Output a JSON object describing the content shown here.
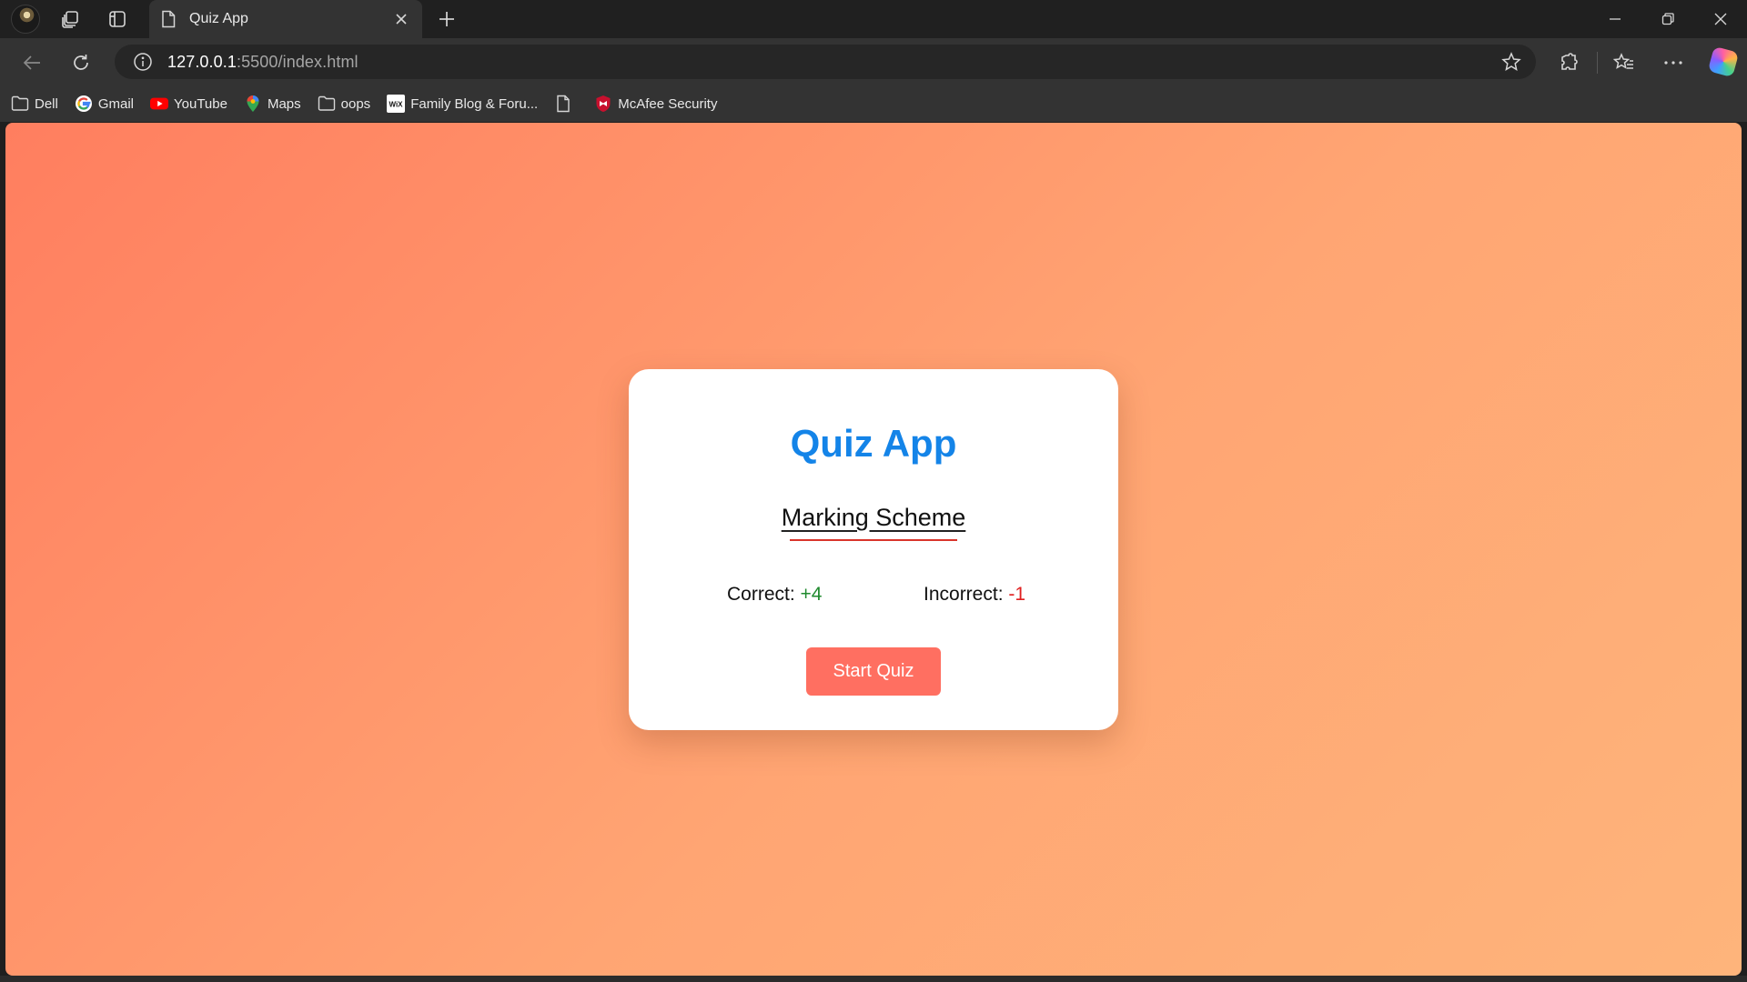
{
  "browser": {
    "tab": {
      "title": "Quiz App"
    },
    "address": {
      "host": "127.0.0.1",
      "rest": ":5500/index.html"
    },
    "bookmarks": [
      {
        "label": "Dell",
        "icon": "folder-icon"
      },
      {
        "label": "Gmail",
        "icon": "google-icon"
      },
      {
        "label": "YouTube",
        "icon": "youtube-icon"
      },
      {
        "label": "Maps",
        "icon": "maps-pin-icon"
      },
      {
        "label": "oops",
        "icon": "folder-icon"
      },
      {
        "label": "Family Blog & Foru...",
        "icon": "wix-icon"
      },
      {
        "label": "",
        "icon": "page-icon"
      },
      {
        "label": "McAfee Security",
        "icon": "mcafee-shield-icon"
      }
    ]
  },
  "page": {
    "title": "Quiz App",
    "subtitle": "Marking Scheme",
    "correct": {
      "label": "Correct:",
      "value": "+4"
    },
    "incorrect": {
      "label": "Incorrect:",
      "value": "-1"
    },
    "start_button": "Start Quiz"
  },
  "colors": {
    "background_from": "#ff7e5f",
    "background_to": "#feb47b",
    "title": "#1484e8",
    "button": "#ff6f61",
    "correct_value": "#1f8a2e",
    "incorrect_value": "#e02020"
  }
}
